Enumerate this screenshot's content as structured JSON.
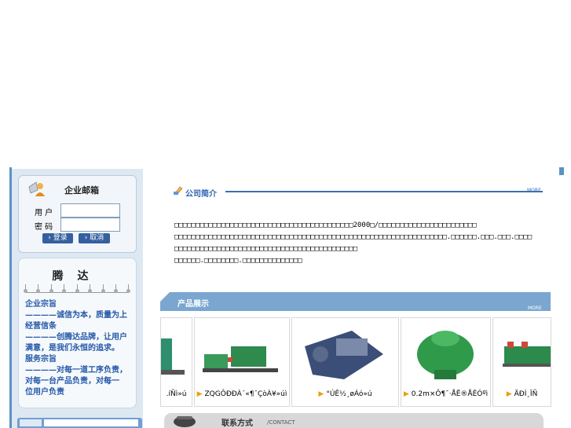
{
  "login": {
    "title": "企业邮箱",
    "user_label": "用 户",
    "pass_label": "密 码",
    "login_button": "登录",
    "cancel_button": "取消"
  },
  "motto": {
    "heading": "腾达",
    "lines": [
      "企业宗旨",
      "  ————诚信为本，质量为上",
      "经营信条",
      "  ————创腾达品牌，让用户",
      "     满意，是我们永恒的追求。",
      "服务宗旨",
      "  ————对每一道工序负责，",
      "    对每一台产品负责，对每一",
      "    位用户负责"
    ]
  },
  "intro": {
    "title": "公司简介",
    "more": "MORE",
    "lines": [
      "□□□□□□□□□□□□□□□□□□□□□□□□□□□□□□□□□□□□□□□□□□2000□/□□□□□□□□□□□□□□□□□□□□□□□",
      "□□□□□□□□□□□□□□□□□□□□□□□□□□□□□□□□□□□□□□□□□□□□□□□□□□□□□□□□□□□□□□□□.□□□□□□.□□□.□□□.□□□□",
      "□□□□□□□□□□□□□□□□□□□□□□□□□□□□□□□□□□□□□□□□□□□",
      "□□□□□□.□□□□□□□□.□□□□□□□□□□□□□□"
    ]
  },
  "products": {
    "title": "产品展示",
    "more": "MORE",
    "items": [
      {
        "label": ".íÑì»ú",
        "color": "#2e8e6e"
      },
      {
        "label": "ZQGÔÐÐÀ´«¶¯ÇòÀ¥»úì",
        "color": "#3a9a5a"
      },
      {
        "label": "°ÚÊ½¸øÁó»ú",
        "color": "#3b4e78"
      },
      {
        "label": "0.2m×Ô¶¯·ÅË®ÅÊÓºì",
        "color": "#2f9a4a"
      },
      {
        "label": "ÄÐÍ¸ÎÑ",
        "color": "#2c8a4c"
      }
    ]
  },
  "contact": {
    "title": "联系方式",
    "subtitle": "/CONTACT"
  }
}
